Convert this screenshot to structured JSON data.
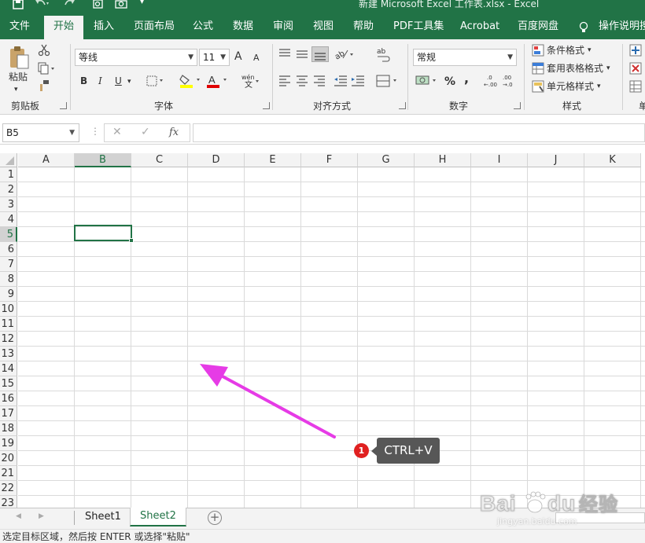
{
  "titlebar": {
    "title": "新建 Microsoft Excel 工作表.xlsx  -  Excel",
    "save_icon": "save-icon",
    "undo_icon": "undo-icon",
    "redo_icon": "redo-icon",
    "preview_icon": "print-preview-icon",
    "camera_icon": "camera-icon",
    "customize_icon": "chevron-down-icon"
  },
  "tabs": {
    "items": [
      "文件",
      "开始",
      "插入",
      "页面布局",
      "公式",
      "数据",
      "审阅",
      "视图",
      "帮助",
      "PDF工具集",
      "Acrobat",
      "百度网盘",
      "操作说明搜"
    ],
    "active": "开始"
  },
  "ribbon": {
    "clipboard": {
      "label": "剪贴板",
      "paste": "粘贴"
    },
    "font": {
      "label": "字体",
      "name": "等线",
      "size": "11",
      "bold": "B",
      "italic": "I",
      "underline": "U",
      "grow": "A",
      "shrink": "A",
      "phonetic": "wén\n文"
    },
    "alignment": {
      "label": "对齐方式"
    },
    "number": {
      "label": "数字",
      "format": "常规",
      "percent": "%",
      "comma": ","
    },
    "styles": {
      "label": "样式",
      "conditional": "条件格式",
      "table": "套用表格格式",
      "cell": "单元格样式"
    },
    "cells": {
      "label": "单"
    }
  },
  "formula_bar": {
    "name_box": "B5",
    "cancel": "✕",
    "enter": "✓",
    "fx": "fx",
    "value": ""
  },
  "grid": {
    "columns": [
      "A",
      "B",
      "C",
      "D",
      "E",
      "F",
      "G",
      "H",
      "I",
      "J",
      "K"
    ],
    "rows": [
      "1",
      "2",
      "3",
      "4",
      "5",
      "6",
      "7",
      "8",
      "9",
      "10",
      "11",
      "12",
      "13",
      "14",
      "15",
      "16",
      "17",
      "18",
      "19",
      "20",
      "21",
      "22",
      "23"
    ],
    "selected_column": "B",
    "selected_row": "5"
  },
  "sheets": {
    "items": [
      "Sheet1",
      "Sheet2"
    ],
    "active": "Sheet2"
  },
  "status": "选定目标区域，然后按 ENTER 或选择\"粘贴\"",
  "annotation": {
    "badge": "1",
    "text": "CTRL+V",
    "arrow_color": "#e63be6"
  },
  "watermark": {
    "text": "Bai du 经验",
    "url": "jingyan.baidu.com"
  },
  "colors": {
    "accent": "#217346",
    "ribbon_bg": "#f3f3f3"
  }
}
